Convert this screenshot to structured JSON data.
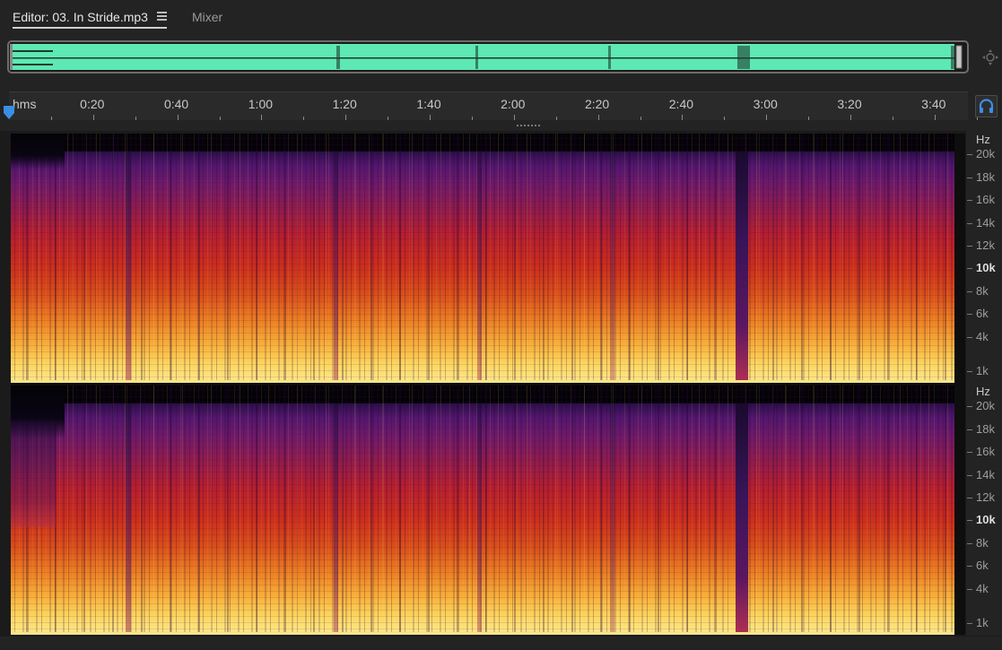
{
  "tabs": {
    "editor_label": "Editor: 03. In Stride.mp3",
    "mixer_label": "Mixer"
  },
  "overview": {
    "waveform_color": "#5ee8b4"
  },
  "ruler": {
    "unit": "hms",
    "ticks": [
      "0:20",
      "0:40",
      "1:00",
      "1:20",
      "1:40",
      "2:00",
      "2:20",
      "2:40",
      "3:00",
      "3:20",
      "3:40"
    ]
  },
  "frequency_axis": {
    "unit": "Hz",
    "labels": [
      "20k",
      "18k",
      "16k",
      "14k",
      "12k",
      "10k",
      "8k",
      "6k",
      "4k",
      "1k"
    ],
    "bold_label": "10k"
  },
  "colors": {
    "accent": "#3a8ee6",
    "playhead": "#3a8ee6",
    "spectral_low": "#fde98e",
    "spectral_mid": "#cc2f1c",
    "spectral_high": "#52176e"
  },
  "icons": {
    "tab_menu": "hamburger-menu-icon",
    "zoom_navigator": "zoom-navigator-icon",
    "headphones": "headphones-icon",
    "playhead": "playhead-marker-icon"
  }
}
